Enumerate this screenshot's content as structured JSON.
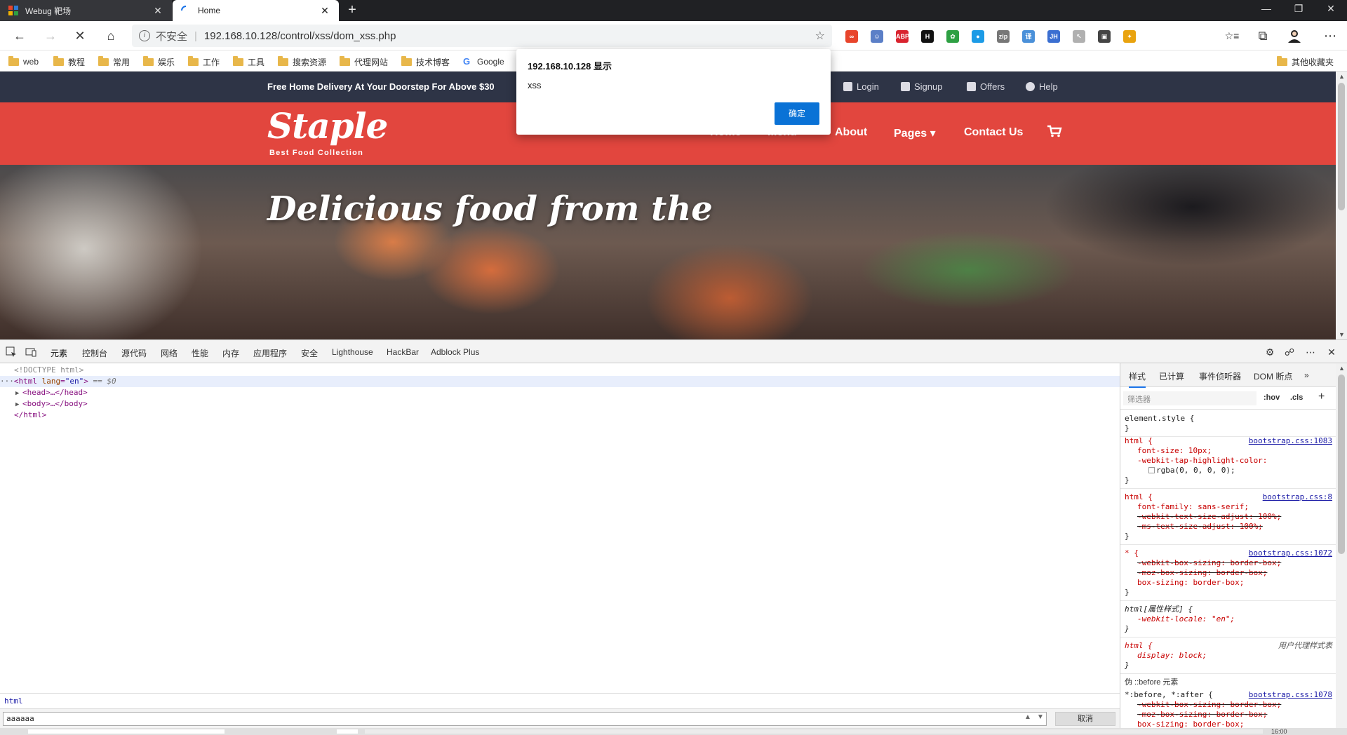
{
  "browser": {
    "tabs": [
      {
        "title": "Webug 靶场",
        "close": "✕"
      },
      {
        "title": "Home",
        "close": "✕"
      }
    ],
    "new_tab": "+",
    "window": {
      "minimize": "—",
      "restore": "❐",
      "close": "✕"
    },
    "nav": {
      "back": "←",
      "forward": "→",
      "stop": "✕",
      "home": "⌂"
    },
    "omnibox": {
      "security": "不安全",
      "url": "192.168.10.128/control/xss/dom_xss.php",
      "star": "☆"
    },
    "extensions": [
      {
        "icon": "infinity-extension-icon",
        "label": "∞",
        "color": "#e8452c"
      },
      {
        "icon": "face-extension-icon",
        "label": "☺",
        "color": "#5b7fc7"
      },
      {
        "icon": "adblock-plus-extension-icon",
        "label": "ABP",
        "color": "#d9232e"
      },
      {
        "icon": "h-extension-icon",
        "label": "H",
        "color": "#111111"
      },
      {
        "icon": "paw-extension-icon",
        "label": "✿",
        "color": "#2ea043"
      },
      {
        "icon": "colorful-extension-icon",
        "label": "●",
        "color": "#1c9be6"
      },
      {
        "icon": "gitzip-extension-icon",
        "label": "zip",
        "color": "#777777"
      },
      {
        "icon": "translate-extension-icon",
        "label": "译",
        "color": "#4a90d9"
      },
      {
        "icon": "jh-extension-icon",
        "label": "JH",
        "color": "#3b6fd1"
      },
      {
        "icon": "cursor-extension-icon",
        "label": "↖",
        "color": "#b0b0b0"
      },
      {
        "icon": "screen-extension-icon",
        "label": "▣",
        "color": "#444444"
      },
      {
        "icon": "pinwheel-extension-icon",
        "label": "✦",
        "color": "#e9a30f"
      }
    ],
    "toolbar_right": {
      "reading_list": "☆≡",
      "collections": "⧉",
      "profile": "avatar",
      "menu": "⋯"
    },
    "bookmarks": [
      "web",
      "教程",
      "常用",
      "娱乐",
      "工作",
      "工具",
      "搜索资源",
      "代理网站",
      "技术博客",
      "Google"
    ],
    "other_bookmarks": "其他收藏夹"
  },
  "site": {
    "promo": "Free Home Delivery At Your Doorstep For Above $30",
    "top_links": [
      "Login",
      "Signup",
      "Offers",
      "Help"
    ],
    "logo": "Staple",
    "tagline": "Best Food Collection",
    "menu": [
      "Home",
      "Menu",
      "About",
      "Pages ▾",
      "Contact Us"
    ],
    "hero_title": "Delicious food from the"
  },
  "dialog": {
    "title": "192.168.10.128 显示",
    "message": "xss",
    "ok": "确定"
  },
  "devtools": {
    "tabs": [
      "元素",
      "控制台",
      "源代码",
      "网络",
      "性能",
      "内存",
      "应用程序",
      "安全",
      "Lighthouse",
      "HackBar",
      "Adblock Plus"
    ],
    "dom": {
      "doctype": "<!DOCTYPE html>",
      "html_open_tag": "html",
      "html_attr": "lang",
      "html_attr_val": "\"en\"",
      "selected_marker": "== $0",
      "head": "<head>…</head>",
      "body": "<body>…</body>",
      "html_close": "</html>"
    },
    "breadcrumb": "html",
    "find_value": "aaaaaa",
    "cancel": "取消",
    "styles_tabs": [
      "样式",
      "已计算",
      "事件侦听器",
      "DOM 断点",
      "»"
    ],
    "filter_placeholder": "筛选器",
    "hov": ":hov",
    "cls": ".cls",
    "plus": "+",
    "rules": [
      {
        "selector": "element.style {",
        "source": "",
        "props": [],
        "close": "}"
      },
      {
        "selector": "html {",
        "source": "bootstrap.css:1083",
        "props": [
          "font-size: 10px;",
          "-webkit-tap-highlight-color:",
          "rgba(0, 0, 0, 0);"
        ],
        "close": "}"
      },
      {
        "selector": "html {",
        "source": "bootstrap.css:8",
        "props": [
          "font-family: sans-serif;",
          "-webkit-text-size-adjust: 100%;",
          "-ms-text-size-adjust: 100%;"
        ],
        "close": "}"
      },
      {
        "selector": "* {",
        "source": "bootstrap.css:1072",
        "props": [
          "-webkit-box-sizing: border-box;",
          "-moz-box-sizing: border-box;",
          "box-sizing: border-box;"
        ],
        "close": "}"
      },
      {
        "selector": "html[属性样式] {",
        "source": "",
        "props": [
          "-webkit-locale: \"en\";"
        ],
        "close": "}"
      },
      {
        "selector": "html {",
        "source": "用户代理样式表",
        "props": [
          "display: block;"
        ],
        "close": "}"
      }
    ],
    "pseudo_header": "伪 ::before 元素",
    "pseudo_rule": {
      "selector": "*:before, *:after {",
      "source": "bootstrap.css:1078",
      "props": [
        "-webkit-box-sizing: border-box;",
        "-moz-box-sizing: border-box;",
        "box-sizing: border-box;"
      ]
    },
    "clock": "16:00"
  }
}
